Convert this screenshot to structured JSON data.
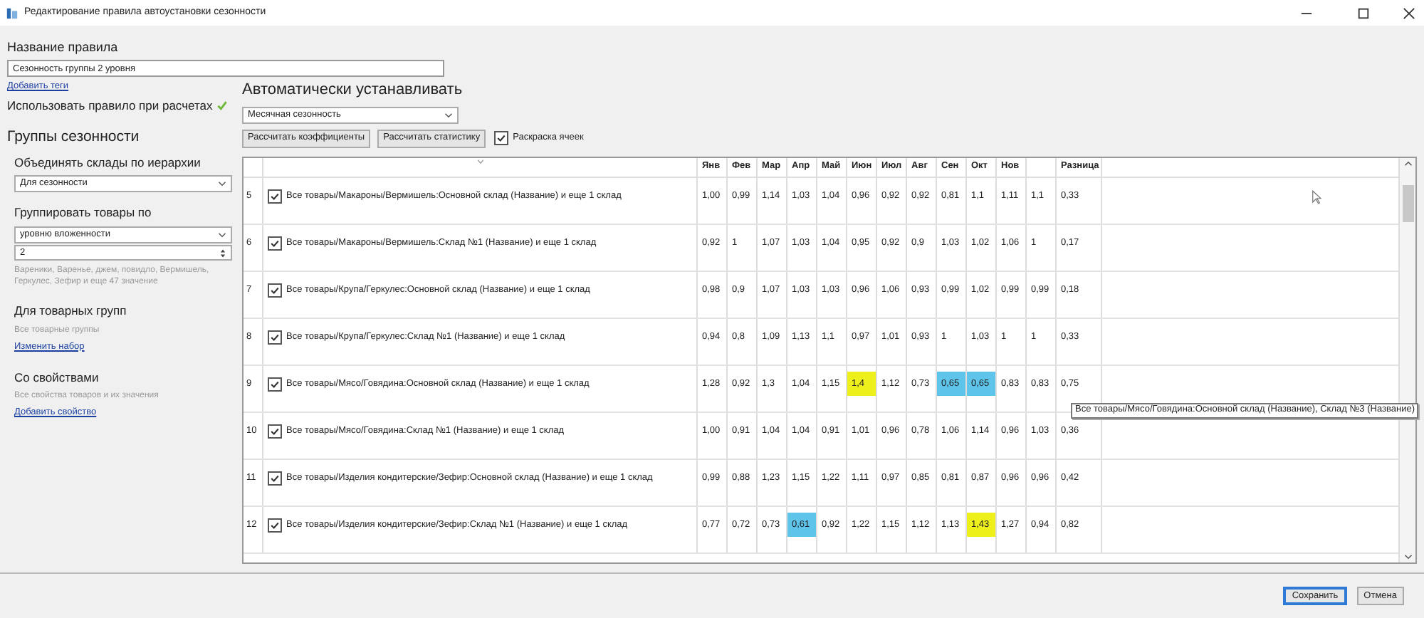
{
  "window": {
    "title": "Редактирование правила автоустановки сезонности"
  },
  "rule_name": {
    "label": "Название правила",
    "value": "Сезонность группы 2 уровня",
    "link": "Добавить теги"
  },
  "use_in_calculations": {
    "label": "Использовать правило при расчетах",
    "checked": true
  },
  "groups": {
    "title": "Группы сезонности",
    "merge_warehouses": {
      "label": "Объединять склады по иерархии",
      "value": "Для сезонности"
    },
    "group_products": {
      "label": "Группировать товары по",
      "value": "уровню вложенности",
      "count": "2",
      "hint": "Вареники, Варенье, джем, повидло, Вермишель, Геркулес, Зефир и еще 47 значение"
    },
    "product_groups": {
      "title": "Для товарных групп",
      "description": "Все товарные группы",
      "link": "Изменить набор"
    },
    "properties": {
      "title": "Со свойствами",
      "description": "Все свойства товаров и их значения",
      "link": "Добавить свойство"
    }
  },
  "auto": {
    "title": "Автоматически устанавливать",
    "mode": "Месячная сезонность",
    "buttons": [
      "Рассчитать коэффициенты",
      "Рассчитать статистику"
    ],
    "coloring": {
      "label": "Раскраска ячеек",
      "checked": true
    }
  },
  "table": {
    "columns": [
      {
        "label": "Янв"
      },
      {
        "label": "Фев"
      },
      {
        "label": "Мар"
      },
      {
        "label": "Апр"
      },
      {
        "label": "Май"
      },
      {
        "label": "Июн"
      },
      {
        "label": "Июл"
      },
      {
        "label": "Авг"
      },
      {
        "label": "Сен"
      },
      {
        "label": "Окт"
      },
      {
        "label": "Нов"
      },
      {},
      {
        "label": "Разница"
      }
    ],
    "rows": [
      {
        "number": "5",
        "checked": true,
        "name": "Все товары/Макароны/Вермишель:Основной склад (Название) и еще 1 склад",
        "cells": [
          "1,00",
          "0,99",
          "1,14",
          "1,03",
          "1,04",
          "0,96",
          "0,92",
          "0,92",
          "0,81",
          "1,1",
          "1,11",
          "1,1",
          "0,33"
        ]
      },
      {
        "number": "6",
        "checked": true,
        "name": "Все товары/Макароны/Вермишель:Склад №1 (Название) и еще 1 склад",
        "cells": [
          "0,92",
          "1",
          "1,07",
          "1,03",
          "1,04",
          "0,95",
          "0,92",
          "0,9",
          "1,03",
          "1,02",
          "1,06",
          "1",
          "0,17"
        ]
      },
      {
        "number": "7",
        "checked": true,
        "name": "Все товары/Крупа/Геркулес:Основной склад (Название) и еще 1 склад",
        "cells": [
          "0,98",
          "0,9",
          "1,07",
          "1,03",
          "1,03",
          "0,96",
          "1,06",
          "0,93",
          "0,99",
          "1,02",
          "0,99",
          "0,99",
          "0,18"
        ]
      },
      {
        "number": "8",
        "checked": true,
        "name": "Все товары/Крупа/Геркулес:Склад №1 (Название) и еще 1 склад",
        "cells": [
          "0,94",
          "0,8",
          "1,09",
          "1,13",
          "1,1",
          "0,97",
          "1,01",
          "0,93",
          "1",
          "1,03",
          "1",
          "1",
          "0,33"
        ]
      },
      {
        "number": "9",
        "checked": true,
        "name": "Все товары/Мясо/Говядина:Основной склад (Название) и еще 1 склад",
        "cells": [
          "1,28",
          "0,92",
          "1,3",
          "1,04",
          "1,15",
          {
            "text": "1,4",
            "color": "#eef01c"
          },
          "1,12",
          "0,73",
          {
            "text": "0,65",
            "color": "#5ec4ea"
          },
          {
            "text": "0,65",
            "color": "#5ec4ea"
          },
          "0,83",
          "0,83",
          "0,75"
        ]
      },
      {
        "number": "10",
        "checked": true,
        "name": "Все товары/Мясо/Говядина:Склад №1 (Название) и еще 1 склад",
        "cells": [
          "1,00",
          "0,91",
          "1,04",
          "1,04",
          "0,91",
          "1,01",
          "0,96",
          "0,78",
          "1,06",
          "1,14",
          "0,96",
          "1,03",
          "0,36"
        ]
      },
      {
        "number": "11",
        "checked": true,
        "name": "Все товары/Изделия кондитерские/Зефир:Основной склад (Название) и еще 1 склад",
        "cells": [
          "0,99",
          "0,88",
          "1,23",
          "1,15",
          "1,22",
          "1,11",
          "0,97",
          "0,85",
          "0,81",
          "0,87",
          "0,96",
          "0,96",
          "0,42"
        ]
      },
      {
        "number": "12",
        "checked": true,
        "name": "Все товары/Изделия кондитерские/Зефир:Склад №1 (Название) и еще 1 склад",
        "cells": [
          "0,77",
          "0,72",
          "0,73",
          {
            "text": "0,61",
            "color": "#5ec4ea"
          },
          "0,92",
          "1,22",
          "1,15",
          "1,12",
          "1,13",
          {
            "text": "1,43",
            "color": "#eef01c"
          },
          "1,27",
          "0,94",
          "0,82"
        ]
      }
    ]
  },
  "tooltip": "Все товары/Мясо/Говядина:Основной склад (Название), Склад №3 (Название)",
  "buttons": [
    {
      "label": "Сохранить",
      "default": true
    },
    {
      "label": "Отмена",
      "default": false
    }
  ]
}
